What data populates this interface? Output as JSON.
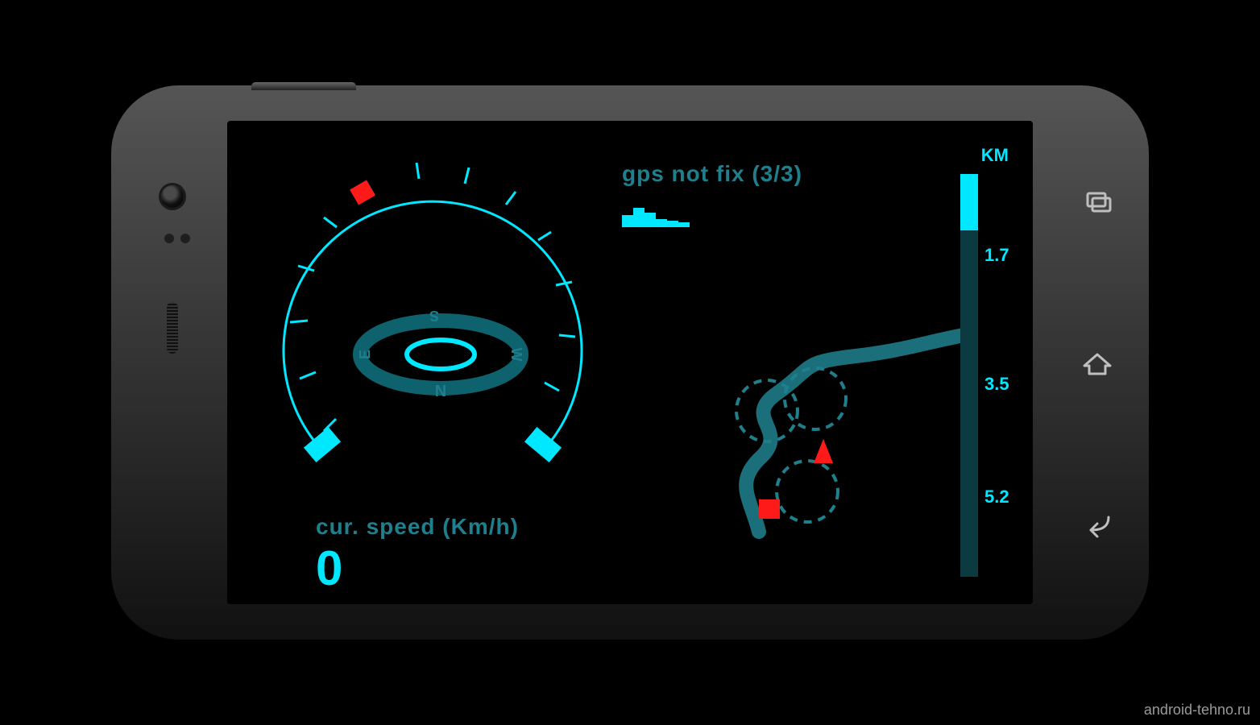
{
  "speed": {
    "label": "cur. speed (Km/h)",
    "value": "0"
  },
  "gps": {
    "label": "gps not fix (3/3)",
    "bars": [
      15,
      24,
      18,
      10,
      8,
      6
    ]
  },
  "compass": {
    "n": "N",
    "s": "S",
    "e": "E",
    "w": "W"
  },
  "distance": {
    "unit": "KM",
    "fill_percent": 14,
    "ticks": [
      {
        "label": "1.7",
        "pos_percent": 20
      },
      {
        "label": "3.5",
        "pos_percent": 52
      },
      {
        "label": "5.2",
        "pos_percent": 80
      }
    ]
  },
  "map": {
    "marker_color": "#ff1a1a",
    "poi_count": 3
  },
  "nav": {
    "recent": "recent",
    "home": "home",
    "back": "back"
  },
  "watermark": "android-tehno.ru"
}
